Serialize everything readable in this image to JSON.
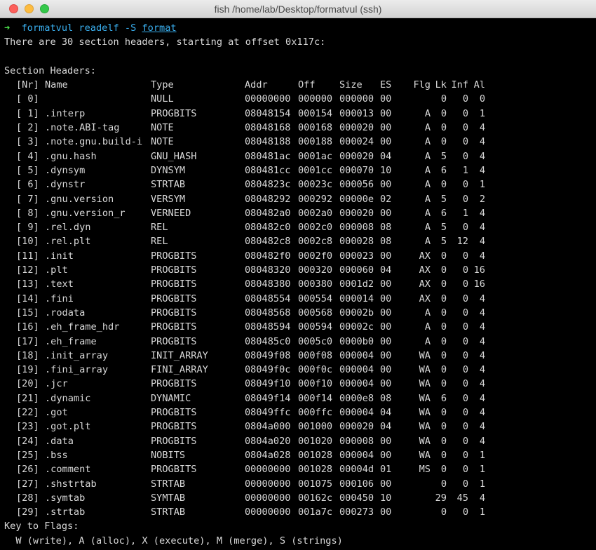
{
  "window": {
    "title": "fish  /home/lab/Desktop/formatvul (ssh)"
  },
  "prompt": {
    "arrow": "➜",
    "cwd": "formatvul",
    "command": "readelf",
    "flag": "-S",
    "argument": "format"
  },
  "output": {
    "summary": "There are 30 section headers, starting at offset 0x117c:",
    "heading": "Section Headers:",
    "columns": {
      "nr": "[Nr]",
      "name": "Name",
      "type": "Type",
      "addr": "Addr",
      "off": "Off",
      "size": "Size",
      "es": "ES",
      "flg": "Flg",
      "lk": "Lk",
      "inf": "Inf",
      "al": "Al"
    },
    "sections": [
      {
        "nr": "[ 0]",
        "name": "",
        "type": "NULL",
        "addr": "00000000",
        "off": "000000",
        "size": "000000",
        "es": "00",
        "flg": "",
        "lk": "0",
        "inf": "0",
        "al": "0"
      },
      {
        "nr": "[ 1]",
        "name": ".interp",
        "type": "PROGBITS",
        "addr": "08048154",
        "off": "000154",
        "size": "000013",
        "es": "00",
        "flg": "A",
        "lk": "0",
        "inf": "0",
        "al": "1"
      },
      {
        "nr": "[ 2]",
        "name": ".note.ABI-tag",
        "type": "NOTE",
        "addr": "08048168",
        "off": "000168",
        "size": "000020",
        "es": "00",
        "flg": "A",
        "lk": "0",
        "inf": "0",
        "al": "4"
      },
      {
        "nr": "[ 3]",
        "name": ".note.gnu.build-i",
        "type": "NOTE",
        "addr": "08048188",
        "off": "000188",
        "size": "000024",
        "es": "00",
        "flg": "A",
        "lk": "0",
        "inf": "0",
        "al": "4"
      },
      {
        "nr": "[ 4]",
        "name": ".gnu.hash",
        "type": "GNU_HASH",
        "addr": "080481ac",
        "off": "0001ac",
        "size": "000020",
        "es": "04",
        "flg": "A",
        "lk": "5",
        "inf": "0",
        "al": "4"
      },
      {
        "nr": "[ 5]",
        "name": ".dynsym",
        "type": "DYNSYM",
        "addr": "080481cc",
        "off": "0001cc",
        "size": "000070",
        "es": "10",
        "flg": "A",
        "lk": "6",
        "inf": "1",
        "al": "4"
      },
      {
        "nr": "[ 6]",
        "name": ".dynstr",
        "type": "STRTAB",
        "addr": "0804823c",
        "off": "00023c",
        "size": "000056",
        "es": "00",
        "flg": "A",
        "lk": "0",
        "inf": "0",
        "al": "1"
      },
      {
        "nr": "[ 7]",
        "name": ".gnu.version",
        "type": "VERSYM",
        "addr": "08048292",
        "off": "000292",
        "size": "00000e",
        "es": "02",
        "flg": "A",
        "lk": "5",
        "inf": "0",
        "al": "2"
      },
      {
        "nr": "[ 8]",
        "name": ".gnu.version_r",
        "type": "VERNEED",
        "addr": "080482a0",
        "off": "0002a0",
        "size": "000020",
        "es": "00",
        "flg": "A",
        "lk": "6",
        "inf": "1",
        "al": "4"
      },
      {
        "nr": "[ 9]",
        "name": ".rel.dyn",
        "type": "REL",
        "addr": "080482c0",
        "off": "0002c0",
        "size": "000008",
        "es": "08",
        "flg": "A",
        "lk": "5",
        "inf": "0",
        "al": "4"
      },
      {
        "nr": "[10]",
        "name": ".rel.plt",
        "type": "REL",
        "addr": "080482c8",
        "off": "0002c8",
        "size": "000028",
        "es": "08",
        "flg": "A",
        "lk": "5",
        "inf": "12",
        "al": "4"
      },
      {
        "nr": "[11]",
        "name": ".init",
        "type": "PROGBITS",
        "addr": "080482f0",
        "off": "0002f0",
        "size": "000023",
        "es": "00",
        "flg": "AX",
        "lk": "0",
        "inf": "0",
        "al": "4"
      },
      {
        "nr": "[12]",
        "name": ".plt",
        "type": "PROGBITS",
        "addr": "08048320",
        "off": "000320",
        "size": "000060",
        "es": "04",
        "flg": "AX",
        "lk": "0",
        "inf": "0",
        "al": "16"
      },
      {
        "nr": "[13]",
        "name": ".text",
        "type": "PROGBITS",
        "addr": "08048380",
        "off": "000380",
        "size": "0001d2",
        "es": "00",
        "flg": "AX",
        "lk": "0",
        "inf": "0",
        "al": "16"
      },
      {
        "nr": "[14]",
        "name": ".fini",
        "type": "PROGBITS",
        "addr": "08048554",
        "off": "000554",
        "size": "000014",
        "es": "00",
        "flg": "AX",
        "lk": "0",
        "inf": "0",
        "al": "4"
      },
      {
        "nr": "[15]",
        "name": ".rodata",
        "type": "PROGBITS",
        "addr": "08048568",
        "off": "000568",
        "size": "00002b",
        "es": "00",
        "flg": "A",
        "lk": "0",
        "inf": "0",
        "al": "4"
      },
      {
        "nr": "[16]",
        "name": ".eh_frame_hdr",
        "type": "PROGBITS",
        "addr": "08048594",
        "off": "000594",
        "size": "00002c",
        "es": "00",
        "flg": "A",
        "lk": "0",
        "inf": "0",
        "al": "4"
      },
      {
        "nr": "[17]",
        "name": ".eh_frame",
        "type": "PROGBITS",
        "addr": "080485c0",
        "off": "0005c0",
        "size": "0000b0",
        "es": "00",
        "flg": "A",
        "lk": "0",
        "inf": "0",
        "al": "4"
      },
      {
        "nr": "[18]",
        "name": ".init_array",
        "type": "INIT_ARRAY",
        "addr": "08049f08",
        "off": "000f08",
        "size": "000004",
        "es": "00",
        "flg": "WA",
        "lk": "0",
        "inf": "0",
        "al": "4"
      },
      {
        "nr": "[19]",
        "name": ".fini_array",
        "type": "FINI_ARRAY",
        "addr": "08049f0c",
        "off": "000f0c",
        "size": "000004",
        "es": "00",
        "flg": "WA",
        "lk": "0",
        "inf": "0",
        "al": "4"
      },
      {
        "nr": "[20]",
        "name": ".jcr",
        "type": "PROGBITS",
        "addr": "08049f10",
        "off": "000f10",
        "size": "000004",
        "es": "00",
        "flg": "WA",
        "lk": "0",
        "inf": "0",
        "al": "4"
      },
      {
        "nr": "[21]",
        "name": ".dynamic",
        "type": "DYNAMIC",
        "addr": "08049f14",
        "off": "000f14",
        "size": "0000e8",
        "es": "08",
        "flg": "WA",
        "lk": "6",
        "inf": "0",
        "al": "4"
      },
      {
        "nr": "[22]",
        "name": ".got",
        "type": "PROGBITS",
        "addr": "08049ffc",
        "off": "000ffc",
        "size": "000004",
        "es": "04",
        "flg": "WA",
        "lk": "0",
        "inf": "0",
        "al": "4"
      },
      {
        "nr": "[23]",
        "name": ".got.plt",
        "type": "PROGBITS",
        "addr": "0804a000",
        "off": "001000",
        "size": "000020",
        "es": "04",
        "flg": "WA",
        "lk": "0",
        "inf": "0",
        "al": "4"
      },
      {
        "nr": "[24]",
        "name": ".data",
        "type": "PROGBITS",
        "addr": "0804a020",
        "off": "001020",
        "size": "000008",
        "es": "00",
        "flg": "WA",
        "lk": "0",
        "inf": "0",
        "al": "4"
      },
      {
        "nr": "[25]",
        "name": ".bss",
        "type": "NOBITS",
        "addr": "0804a028",
        "off": "001028",
        "size": "000004",
        "es": "00",
        "flg": "WA",
        "lk": "0",
        "inf": "0",
        "al": "1"
      },
      {
        "nr": "[26]",
        "name": ".comment",
        "type": "PROGBITS",
        "addr": "00000000",
        "off": "001028",
        "size": "00004d",
        "es": "01",
        "flg": "MS",
        "lk": "0",
        "inf": "0",
        "al": "1"
      },
      {
        "nr": "[27]",
        "name": ".shstrtab",
        "type": "STRTAB",
        "addr": "00000000",
        "off": "001075",
        "size": "000106",
        "es": "00",
        "flg": "",
        "lk": "0",
        "inf": "0",
        "al": "1"
      },
      {
        "nr": "[28]",
        "name": ".symtab",
        "type": "SYMTAB",
        "addr": "00000000",
        "off": "00162c",
        "size": "000450",
        "es": "10",
        "flg": "",
        "lk": "29",
        "inf": "45",
        "al": "4"
      },
      {
        "nr": "[29]",
        "name": ".strtab",
        "type": "STRTAB",
        "addr": "00000000",
        "off": "001a7c",
        "size": "000273",
        "es": "00",
        "flg": "",
        "lk": "0",
        "inf": "0",
        "al": "1"
      }
    ],
    "key_heading": "Key to Flags:",
    "key_line": "  W (write), A (alloc), X (execute), M (merge), S (strings)"
  },
  "colors": {
    "background": "#000000",
    "text": "#d9d9d9",
    "prompt_arrow": "#4be04b",
    "prompt_text": "#3ab0f0"
  }
}
